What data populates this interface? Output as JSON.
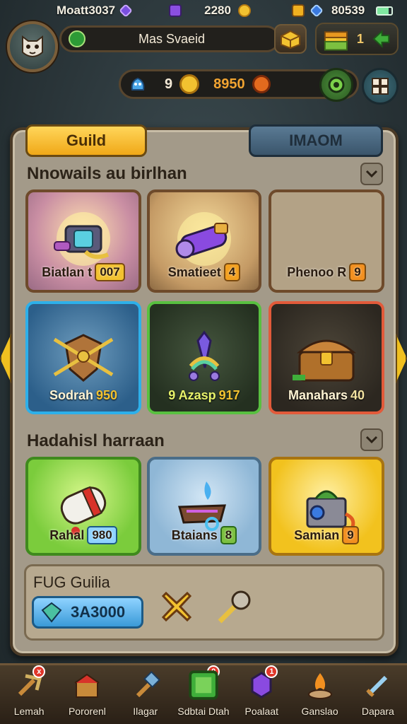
{
  "status_bar": {
    "player_label": "Moatt3037",
    "gems": "2280",
    "coins": "80539"
  },
  "header": {
    "player_name": "Mas Svaeid",
    "crate_count": "1"
  },
  "resources": {
    "level": "9",
    "gold": "8950"
  },
  "tabs": [
    {
      "label": "Guild",
      "active": true
    },
    {
      "label": "IMAOM",
      "active": false
    }
  ],
  "sections": [
    {
      "title": "Nnowails au birlhan",
      "items": [
        {
          "name": "Biatlan t",
          "value": "007",
          "style": "purple"
        },
        {
          "name": "Smatieet",
          "value": "4",
          "style": "tan"
        },
        {
          "name": "Phenoo R",
          "value": "9",
          "style": "empty"
        },
        {
          "name": "Sodrah",
          "value": "950",
          "style": "blue"
        },
        {
          "name": "9 Azasp",
          "value": "917",
          "style": "green"
        },
        {
          "name": "Manahars",
          "value": "40",
          "style": "red"
        }
      ]
    },
    {
      "title": "Hadahisl harraan",
      "items": [
        {
          "name": "Rahal",
          "value": "980",
          "style": "lime"
        },
        {
          "name": "Btaians",
          "value": "8",
          "style": "sky"
        },
        {
          "name": "Samian",
          "value": "9",
          "style": "gold"
        }
      ]
    }
  ],
  "guild_fund": {
    "title": "FUG Guilia",
    "gems": "3A3000"
  },
  "nav": [
    {
      "label": "Lemah",
      "icon": "pickaxe-icon",
      "notif": "x"
    },
    {
      "label": "Pororenl",
      "icon": "workshop-icon",
      "notif": ""
    },
    {
      "label": "Ilagar",
      "icon": "hammer-icon",
      "notif": ""
    },
    {
      "label": "Sdbtai Dtah",
      "icon": "green-gem-icon",
      "notif": "0",
      "active": true
    },
    {
      "label": "Poalaat",
      "icon": "purple-crystal-icon",
      "notif": "1"
    },
    {
      "label": "Ganslao",
      "icon": "campfire-icon",
      "notif": ""
    },
    {
      "label": "Dapara",
      "icon": "sword-icon",
      "notif": ""
    }
  ]
}
